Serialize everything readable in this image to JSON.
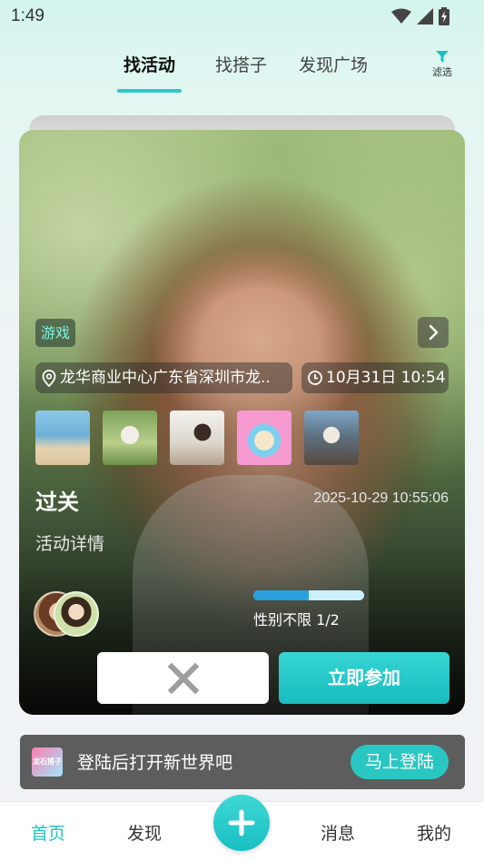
{
  "status_bar": {
    "time": "1:49"
  },
  "tabs": [
    {
      "label": "找活动",
      "active": true
    },
    {
      "label": "找搭子",
      "active": false
    },
    {
      "label": "发现广场",
      "active": false
    }
  ],
  "filter": {
    "label": "滤选",
    "icon": "filter-icon"
  },
  "card": {
    "tag": "游戏",
    "location": "龙华商业中心广东省深圳市龙..",
    "time": "10月31日 10:54",
    "title": "过关",
    "created_at": "2025-10-29 10:55:06",
    "detail_label": "活动详情",
    "gender_text": "性别不限 1/2",
    "participants": 1,
    "capacity": 2,
    "skip_icon": "close-x-icon",
    "join_label": "立即参加",
    "accent": "#2cc8c8"
  },
  "login_banner": {
    "text": "登陆后打开新世界吧",
    "button": "马上登陆",
    "logo_text": "龙石搭子"
  },
  "bottom_nav": [
    {
      "label": "首页",
      "active": true
    },
    {
      "label": "发现",
      "active": false
    },
    {
      "label": "消息",
      "active": false
    },
    {
      "label": "我的",
      "active": false
    }
  ],
  "fab_icon": "plus-icon"
}
